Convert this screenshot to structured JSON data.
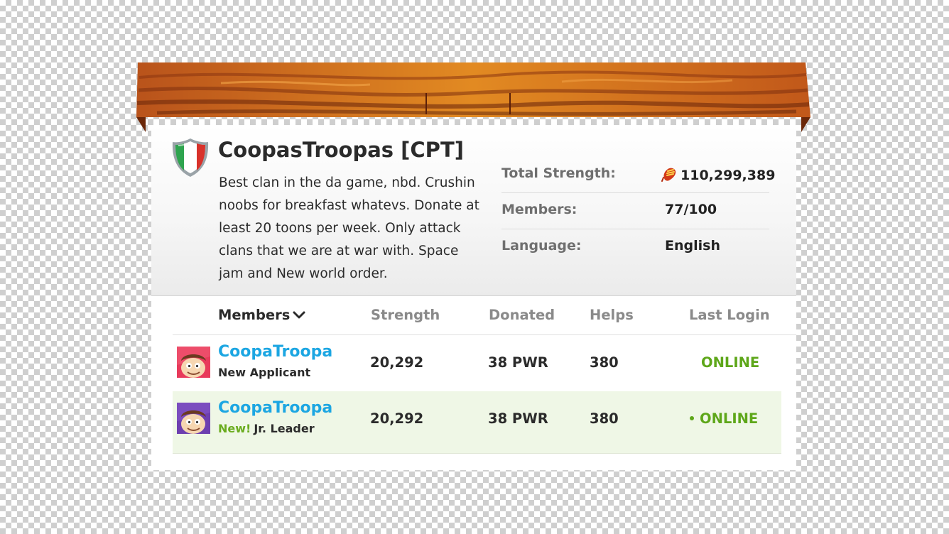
{
  "clan": {
    "name": "CoopasTroopas [CPT]",
    "description": "Best clan in the da game, nbd. Crushin noobs for breakfast whatevs. Donate at least 20 toons per week. Only attack clans that we are at war with. Space jam and New world order.",
    "crest_colors": [
      "#2ea44f",
      "#ffffff",
      "#d8322b"
    ]
  },
  "stats": {
    "total_strength_label": "Total Strength:",
    "total_strength_value": "110,299,389",
    "strength_icon": "fist-icon",
    "members_label": "Members:",
    "members_value": "77/100",
    "language_label": "Language:",
    "language_value": "English"
  },
  "table": {
    "headers": {
      "members": "Members",
      "strength": "Strength",
      "donated": "Donated",
      "helps": "Helps",
      "last_login": "Last Login"
    },
    "rows": [
      {
        "name": "CoopaTroopa",
        "role_new": "",
        "role": "New Applicant",
        "strength": "20,292",
        "donated": "38 PWR",
        "helps": "380",
        "last_login": "ONLINE",
        "avatar_bg": "#e83a5b"
      },
      {
        "name": "CoopaTroopa",
        "role_new": "New!",
        "role": "Jr. Leader",
        "strength": "20,292",
        "donated": "38 PWR",
        "helps": "380",
        "last_login": "ONLINE",
        "avatar_bg": "#6d3fb0"
      }
    ]
  },
  "colors": {
    "accent_link": "#1ca6e2",
    "online_green": "#5ea71a",
    "highlight_row": "#eff7e6",
    "wood_orange": "#d9711a"
  }
}
